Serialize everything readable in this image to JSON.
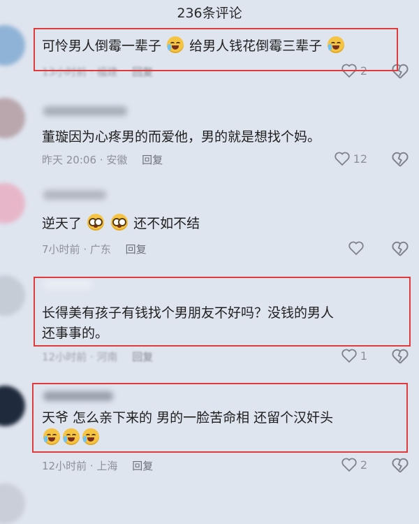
{
  "header": {
    "title": "236条评论"
  },
  "comments": [
    {
      "text": "可怜男人倒霉一辈子",
      "text2": "给男人钱花倒霉三辈子",
      "time": "13小时前",
      "location": "福建",
      "reply": "回复",
      "likes": "2"
    },
    {
      "text": "董璇因为心疼男的而爱他，男的就是想找个妈。",
      "time": "昨天 20:06",
      "location": "安徽",
      "reply": "回复",
      "likes": "12"
    },
    {
      "text": "逆天了",
      "text2": "还不如不结",
      "time": "7小时前",
      "location": "广东",
      "reply": "回复",
      "likes": ""
    },
    {
      "text": "长得美有孩子有钱找个男朋友不好吗？没钱的男人",
      "text2": "还事事的。",
      "time": "12小时前",
      "location": "河南",
      "reply": "回复",
      "likes": "1"
    },
    {
      "text": "天爷 怎么亲下来的 男的一脸苦命相 还留个汉奸头",
      "time": "12小时前",
      "location": "上海",
      "reply": "回复",
      "likes": "2"
    }
  ],
  "colors": {
    "highlight_box": "#e03a3a",
    "background": "#dfe5ef"
  },
  "icons": [
    "like-heart-icon",
    "dislike-broken-heart-icon",
    "crying-emoji-icon",
    "shocked-emoji-icon"
  ]
}
